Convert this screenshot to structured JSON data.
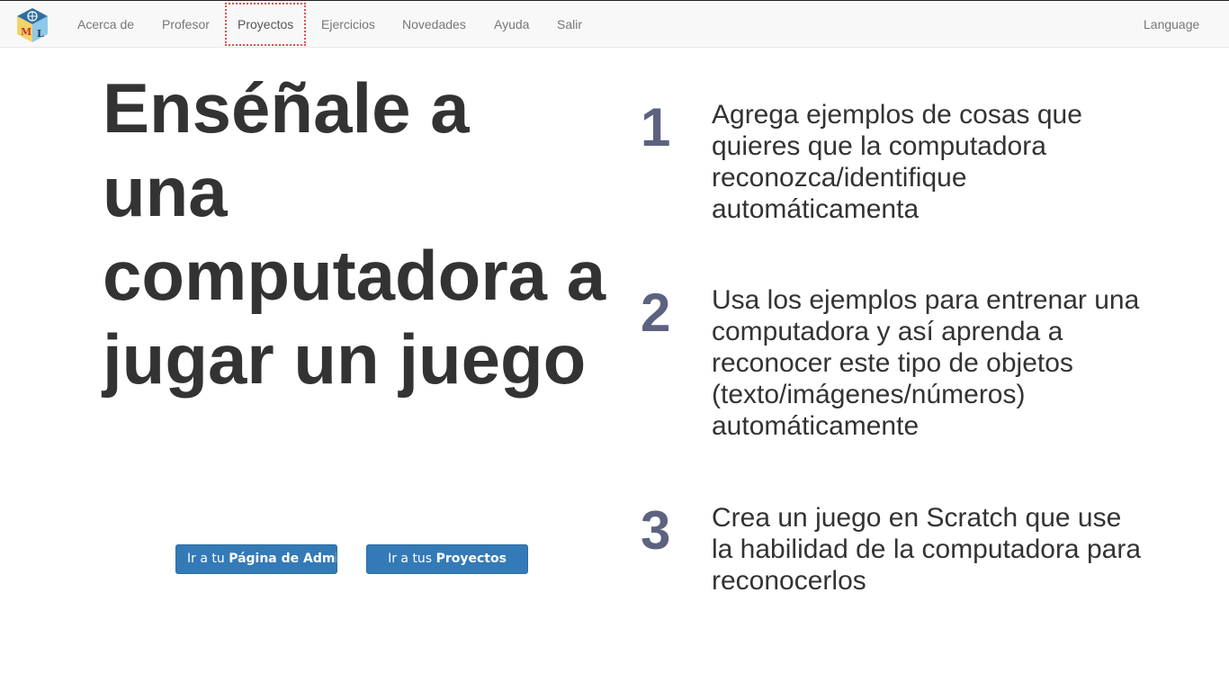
{
  "nav": {
    "items": [
      {
        "label": "Acerca de",
        "name": "nav-acerca-de"
      },
      {
        "label": "Profesor",
        "name": "nav-profesor"
      },
      {
        "label": "Proyectos",
        "name": "nav-proyectos"
      },
      {
        "label": "Ejercicios",
        "name": "nav-ejercicios"
      },
      {
        "label": "Novedades",
        "name": "nav-novedades"
      },
      {
        "label": "Ayuda",
        "name": "nav-ayuda"
      },
      {
        "label": "Salir",
        "name": "nav-salir"
      }
    ],
    "active": "Proyectos",
    "language": "Language",
    "logo_icon": "ml-cube-logo-icon",
    "logo_letters": [
      "M",
      "L"
    ]
  },
  "hero": {
    "title": "Enséñale a una computadora a jugar un juego"
  },
  "buttons": {
    "admin_prefix": "Ir a tu ",
    "admin_bold": "Página de Administración",
    "projects_prefix": "Ir a tus ",
    "projects_bold": "Proyectos"
  },
  "steps": [
    {
      "number": "1",
      "text": "Agrega ejemplos de cosas que quieres que la computadora reconozca/identifique automáticamenta"
    },
    {
      "number": "2",
      "text": "Usa los ejemplos para entrenar una computadora y así aprenda a reconocer este tipo de objetos (texto/imágenes/números) automáticamente"
    },
    {
      "number": "3",
      "text": "Crea un juego en Scratch que use la habilidad de la computadora para reconocerlos"
    }
  ],
  "colors": {
    "primary": "#337ab7",
    "step_number": "#5d6280",
    "nav_bg": "#f8f8f8",
    "active_outline": "#d9534f"
  }
}
